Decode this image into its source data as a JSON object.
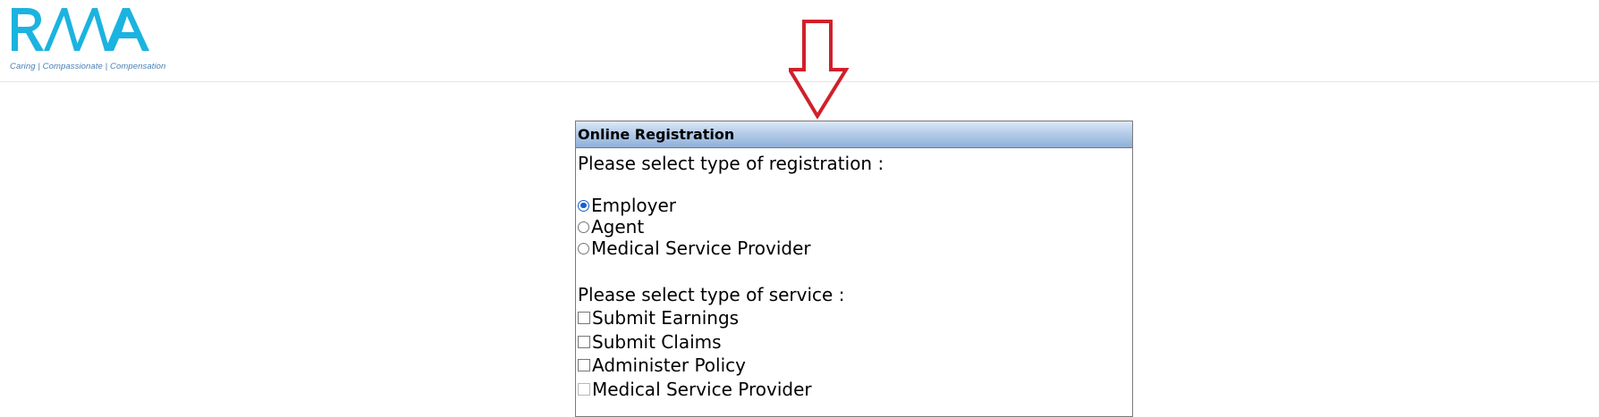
{
  "header": {
    "logo_text": "RMA",
    "logo_tagline": "Caring | Compassionate | Compensation",
    "brand_color": "#1bb3e0",
    "tagline_color": "#4a7fb5"
  },
  "annotation": {
    "icon": "arrow-down-icon",
    "color": "#d0202a"
  },
  "registration": {
    "title": "Online Registration",
    "registration_prompt": "Please select type of registration :",
    "registration_types": [
      {
        "label": "Employer",
        "selected": true
      },
      {
        "label": "Agent",
        "selected": false
      },
      {
        "label": "Medical Service Provider",
        "selected": false
      }
    ],
    "service_prompt": "Please select type of service :",
    "services": [
      {
        "label": "Submit Earnings",
        "checked": false,
        "enabled": true
      },
      {
        "label": "Submit Claims",
        "checked": false,
        "enabled": true
      },
      {
        "label": "Administer Policy",
        "checked": false,
        "enabled": true
      },
      {
        "label": "Medical Service Provider",
        "checked": false,
        "enabled": false
      }
    ]
  }
}
